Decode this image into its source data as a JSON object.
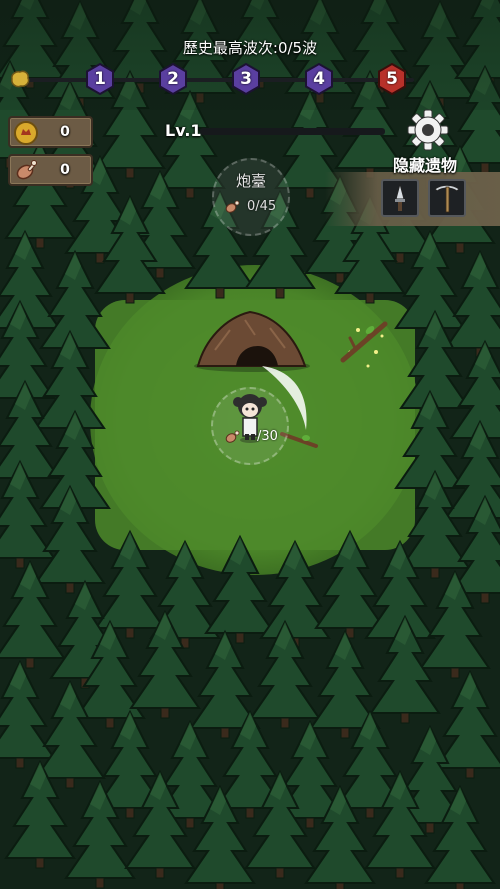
{
  "hud": {
    "record_label": "歷史最高波次:0/5波",
    "waves": [
      {
        "label": "1",
        "color": "#5a3fa0"
      },
      {
        "label": "2",
        "color": "#5a3fa0"
      },
      {
        "label": "3",
        "color": "#5a3fa0"
      },
      {
        "label": "4",
        "color": "#5a3fa0"
      },
      {
        "label": "5",
        "color": "#b8312a"
      }
    ],
    "progress": 0
  },
  "resources": {
    "coins": {
      "icon": "coin-icon",
      "value": "0"
    },
    "meat": {
      "icon": "meat-icon",
      "value": "0"
    }
  },
  "level": {
    "label": "Lv.1",
    "xp_fraction": 0
  },
  "settings": {
    "icon": "gear-icon"
  },
  "relics": {
    "title": "隐藏遗物",
    "slots": [
      {
        "icon": "knife-icon"
      },
      {
        "icon": "pickaxe-icon"
      }
    ]
  },
  "turret": {
    "label": "炮臺",
    "cost_text": "0/45",
    "cost_icon": "meat-icon"
  },
  "player": {
    "cost_text": "/30",
    "cost_icon": "meat-icon"
  },
  "colors": {
    "grass": "#4d8a2a",
    "forest": "#1d3a25",
    "gold": "#d9a92c"
  }
}
